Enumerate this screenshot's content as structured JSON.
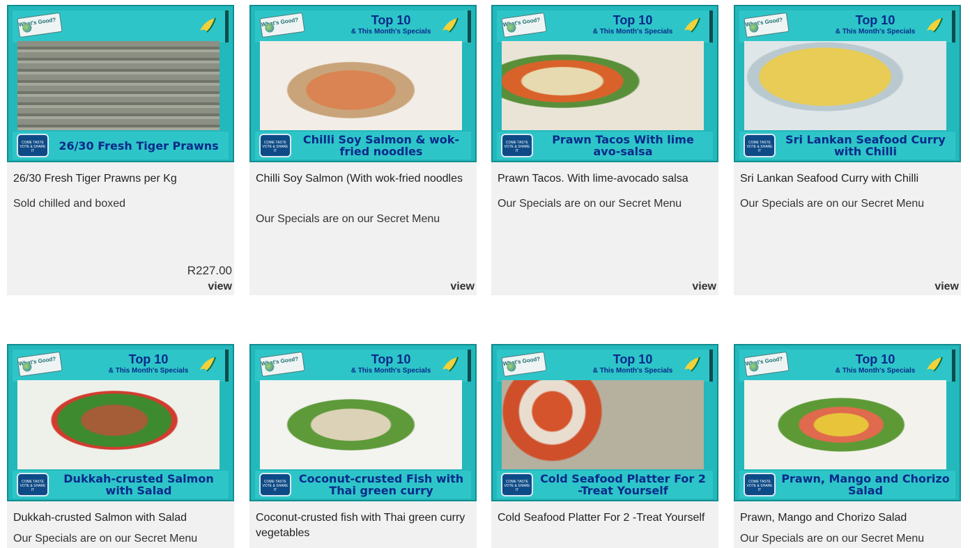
{
  "header": {
    "sign_text": "What's Good?",
    "top10": "Top 10",
    "specials": "& This Month's Specials",
    "badge_text": "COME TASTE VOTE & SHARE IT"
  },
  "products": [
    {
      "tile_title": "26/30 Fresh Tiger Prawns",
      "name": "26/30 Fresh Tiger Prawns per Kg",
      "subtitle": "Sold chilled and boxed",
      "price": "R227.00",
      "view": "view"
    },
    {
      "tile_title": "Chilli Soy Salmon & wok-fried noodles",
      "name": "Chilli Soy Salmon (With wok-fried noodles",
      "subtitle": "Our Specials are on our Secret Menu",
      "view": "view"
    },
    {
      "tile_title": "Prawn Tacos With lime avo-salsa",
      "name": "Prawn Tacos. With lime-avocado salsa",
      "subtitle": "Our Specials are on our Secret Menu",
      "view": "view"
    },
    {
      "tile_title": "Sri Lankan Seafood Curry with Chilli",
      "name": "Sri Lankan Seafood Curry with Chilli",
      "subtitle": "Our Specials are on our Secret Menu",
      "view": "view"
    },
    {
      "tile_title": "Dukkah-crusted Salmon with Salad",
      "name": "Dukkah-crusted Salmon with Salad",
      "subtitle": "Our Specials are on our Secret Menu"
    },
    {
      "tile_title": "Coconut-crusted Fish with Thai green curry",
      "name": "Coconut-crusted fish with Thai green curry vegetables"
    },
    {
      "tile_title": "Cold Seafood Platter For 2 -Treat Yourself",
      "name": "Cold Seafood Platter For 2 -Treat Yourself"
    },
    {
      "tile_title": "Prawn, Mango and Chorizo Salad",
      "name": "Prawn, Mango and Chorizo Salad",
      "subtitle": "Our Specials are on our Secret Menu"
    }
  ],
  "colors": {
    "tile_bg": "#23b8bb",
    "title_blue": "#0a2a8a",
    "card_bg": "#f1f1f1"
  }
}
